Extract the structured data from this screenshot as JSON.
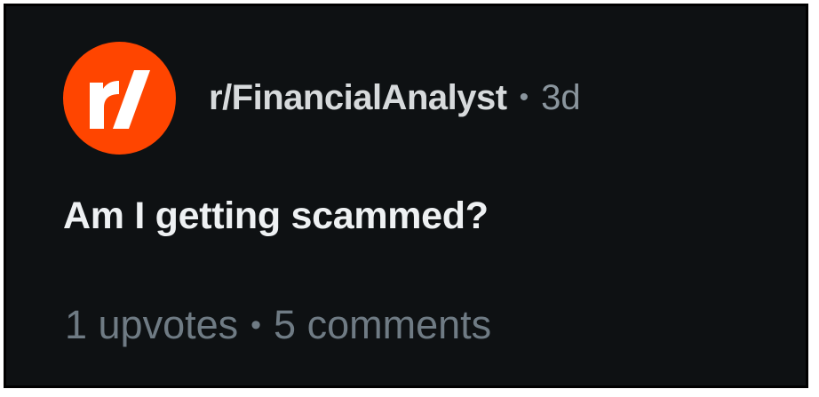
{
  "post": {
    "subreddit_icon": "reddit-r-slash-logo",
    "subreddit_icon_text": "r/",
    "subreddit": "r/FinancialAnalyst",
    "separator": "•",
    "age": "3d",
    "title": "Am I getting scammed?",
    "upvotes": "1 upvotes",
    "comments": "5 comments"
  },
  "colors": {
    "background": "#0e1113",
    "accent": "#ff4500",
    "subreddit_text": "#d7dadc",
    "muted_text": "#8a959d",
    "title_text": "#eef1f3"
  }
}
